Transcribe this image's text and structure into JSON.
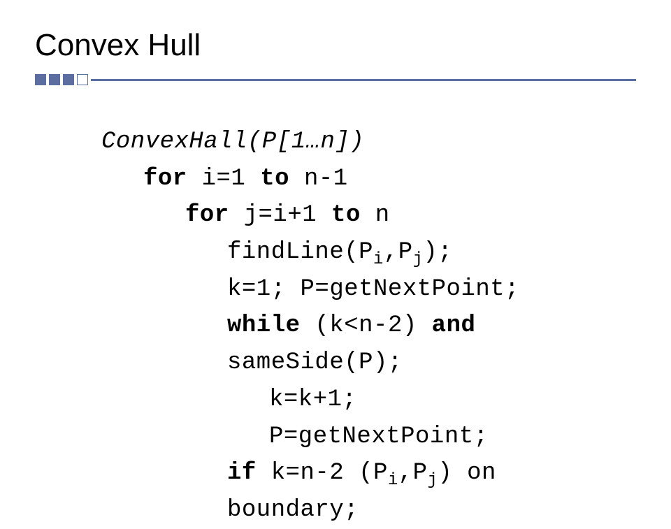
{
  "title": "Convex Hull",
  "code": {
    "l1_fn": "ConvexHall(P[1…n])",
    "l2_for": "for",
    "l2_rest": " i=1 ",
    "l2_to": "to",
    "l2_end": " n-1",
    "l3_for": "for",
    "l3_rest": " j=i+1 ",
    "l3_to": "to",
    "l3_end": " n",
    "l4": "findLine(P",
    "l4_i": "i",
    "l4_mid": ",P",
    "l4_j": "j",
    "l4_end": ");",
    "l5": "k=1; P=getNextPoint;",
    "l6_while": "while",
    "l6_mid": " (k<n-2) ",
    "l6_and": "and",
    "l6_end": " sameSide(P);",
    "l7": "k=k+1;",
    "l8": "P=getNextPoint;",
    "l9_if": "if",
    "l9_mid1": " k=n-2 (P",
    "l9_i": "i",
    "l9_mid2": ",P",
    "l9_j": "j",
    "l9_end": ") on boundary;"
  }
}
